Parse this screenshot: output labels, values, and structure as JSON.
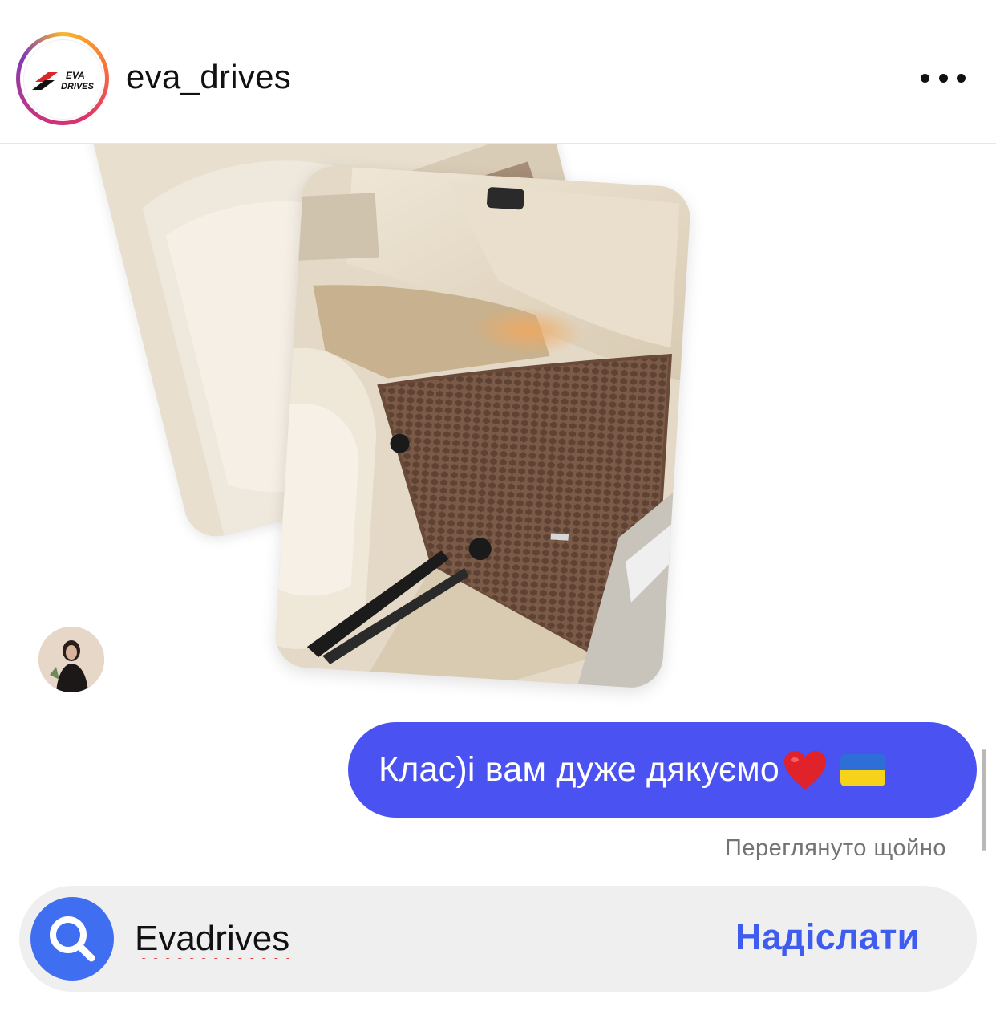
{
  "header": {
    "username": "eva_drives",
    "logo_text_top": "EVA",
    "logo_text_bottom": "DRIVES",
    "more_icon": "more-horizontal-icon"
  },
  "chat": {
    "message": "Клас)і вам дуже дякуємо",
    "emojis": [
      "heart-emoji",
      "ukraine-flag-emoji"
    ],
    "seen_status": "Переглянуто щойно"
  },
  "composer": {
    "search_icon": "search-icon",
    "input_value": "Evadrives",
    "send_label": "Надіслати"
  },
  "colors": {
    "bubble": "#4a53f1",
    "send": "#3f5cf0",
    "search_button": "#3f6ff0",
    "composer_bg": "#efefef"
  }
}
